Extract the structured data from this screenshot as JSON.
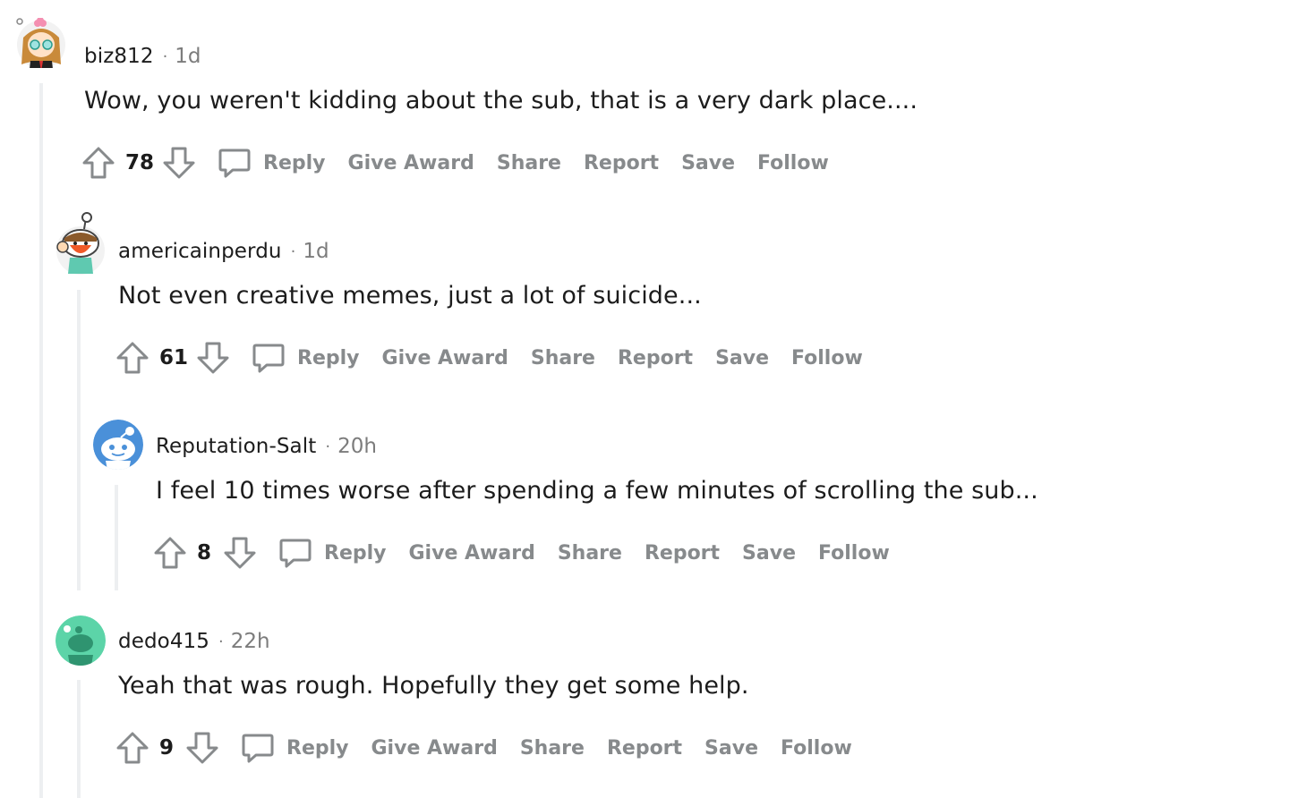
{
  "comments": [
    {
      "username": "biz812",
      "separator": "·",
      "time": "1d",
      "text": "Wow, you weren't kidding about the sub, that is a very dark place....",
      "score": "78",
      "actions": {
        "reply": "Reply",
        "award": "Give Award",
        "share": "Share",
        "report": "Report",
        "save": "Save",
        "follow": "Follow"
      },
      "avatar_icon": "snoo-avatar-blonde-glasses"
    },
    {
      "username": "americainperdu",
      "separator": "·",
      "time": "1d",
      "text": "Not even creative memes, just a lot of suicide...",
      "score": "61",
      "actions": {
        "reply": "Reply",
        "award": "Give Award",
        "share": "Share",
        "report": "Report",
        "save": "Save",
        "follow": "Follow"
      },
      "avatar_icon": "snoo-avatar-red-mask"
    },
    {
      "username": "Reputation-Salt",
      "separator": "·",
      "time": "20h",
      "text": "I feel 10 times worse after spending a few minutes of scrolling the sub...",
      "score": "8",
      "actions": {
        "reply": "Reply",
        "award": "Give Award",
        "share": "Share",
        "report": "Report",
        "save": "Save",
        "follow": "Follow"
      },
      "avatar_icon": "snoo-avatar-blue-default"
    },
    {
      "username": "dedo415",
      "separator": "·",
      "time": "22h",
      "text": "Yeah that was rough. Hopefully they get some help.",
      "score": "9",
      "actions": {
        "reply": "Reply",
        "award": "Give Award",
        "share": "Share",
        "report": "Report",
        "save": "Save",
        "follow": "Follow"
      },
      "avatar_icon": "snoo-avatar-green-default"
    }
  ],
  "colors": {
    "text": "#1c1c1c",
    "meta": "#7c7c7c",
    "action": "#878a8c",
    "thread_line": "#edeff1"
  }
}
